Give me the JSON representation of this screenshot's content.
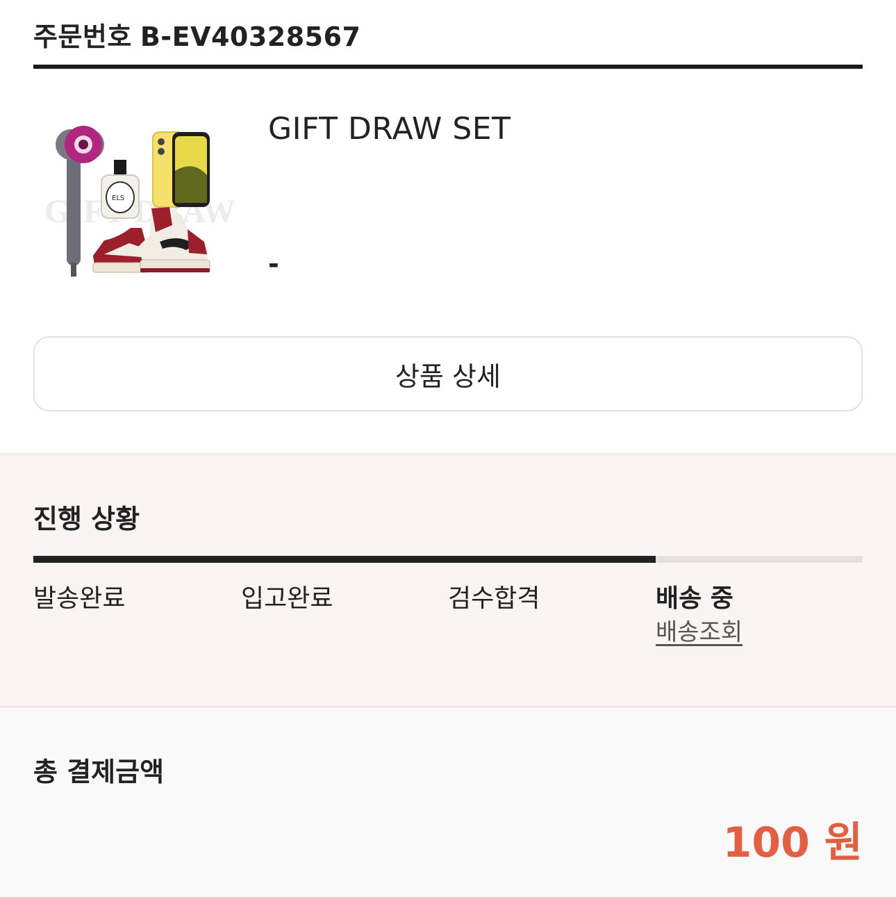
{
  "order": {
    "label": "주문번호",
    "number": "B-EV40328567"
  },
  "product": {
    "name": "GIFT DRAW SET",
    "option": "-",
    "image_overlay_text": "GIFT DRAW"
  },
  "detail_button": {
    "label": "상품 상세"
  },
  "progress": {
    "title": "진행 상황",
    "fill_fraction": 0.75,
    "steps": [
      {
        "label": "발송완료"
      },
      {
        "label": "입고완료"
      },
      {
        "label": "검수합격"
      },
      {
        "label": "배송 중"
      }
    ],
    "current_step_index": 3,
    "tracking_link": "배송조회"
  },
  "payment": {
    "label": "총 결제금액",
    "amount": "100 원"
  },
  "colors": {
    "accent": "#e15f43",
    "progress_fill": "#222222",
    "progress_track": "#e6e1e0",
    "progress_bg": "#faf5f4"
  }
}
